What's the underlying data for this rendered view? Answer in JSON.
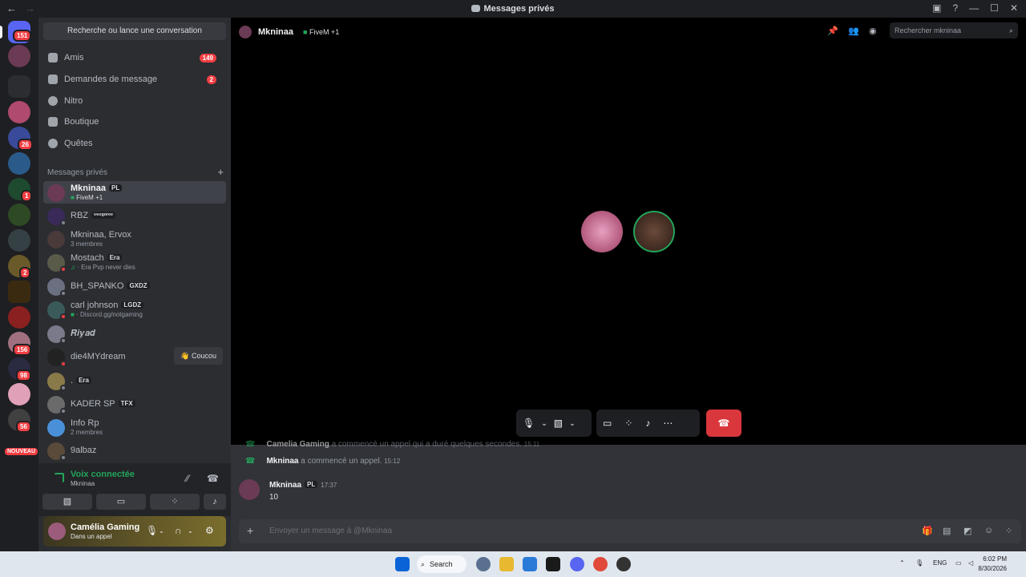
{
  "window": {
    "title": "Messages privés"
  },
  "guilds": {
    "dm_badge": "151",
    "badges": [
      "26",
      "1",
      "2",
      "156",
      "98",
      "56"
    ],
    "new_label": "NOUVEAU"
  },
  "sidebar": {
    "search_label": "Recherche ou lance une conversation",
    "nav": [
      {
        "label": "Amis",
        "count": "149"
      },
      {
        "label": "Demandes de message",
        "count": "2"
      },
      {
        "label": "Nitro",
        "count": ""
      },
      {
        "label": "Boutique",
        "count": ""
      },
      {
        "label": "Quêtes",
        "count": ""
      }
    ],
    "dm_header": "Messages privés",
    "dm_add": "+",
    "dms": [
      {
        "name": "Mkninaa",
        "tag": "PL",
        "sub": "FiveM +1",
        "active": true
      },
      {
        "name": "RBZ",
        "tag": "ᵛ⁶ᵉᵍᵒʳᵉᵉ",
        "sub": ""
      },
      {
        "name": "Mkninaa, Ervox",
        "tag": "",
        "sub": "3 membres"
      },
      {
        "name": "Mostach",
        "tag": "Era",
        "sub": "· Era Pvp never dies"
      },
      {
        "name": "BH_SPANKO",
        "tag": "GXDZ",
        "sub": ""
      },
      {
        "name": "carl johnson",
        "tag": "LGDZ",
        "sub": "· Discord.gg/notgaming"
      },
      {
        "name": "𝑹𝒊𝒚𝒂𝒅",
        "tag": "",
        "sub": ""
      },
      {
        "name": "die4MYdream",
        "tag": "",
        "sub": "",
        "action": "Coucou"
      },
      {
        "name": ".",
        "tag": "Era",
        "sub": ""
      },
      {
        "name": "KADER SP",
        "tag": "TFX",
        "sub": ""
      },
      {
        "name": "Info Rp",
        "tag": "",
        "sub": "2 membres"
      },
      {
        "name": "9albaz",
        "tag": "",
        "sub": ""
      }
    ]
  },
  "voice": {
    "status": "Voix connectée",
    "channel": "Mkninaa"
  },
  "user": {
    "name": "Camélia Gaming",
    "status": "Dans un appel"
  },
  "call": {
    "name": "Mkninaa",
    "activity": "FiveM +1",
    "search_placeholder": "Rechercher mkninaa"
  },
  "messages": {
    "system1": {
      "user": "Camelia Gaming",
      "text": "a commencé un appel qui a duré quelques secondes.",
      "time": "15:11"
    },
    "system2": {
      "user": "Mkninaa",
      "text": "a commencé un appel.",
      "time": "15:12"
    },
    "msg": {
      "user": "Mkninaa",
      "tag": "PL",
      "time": "17:37",
      "body": "10"
    }
  },
  "composer": {
    "placeholder": "Envoyer un message à @Mkninaa"
  },
  "taskbar": {
    "search": "Search",
    "lang": "ENG",
    "time": "6:02 PM",
    "date": "8/30/2026"
  },
  "colors": {
    "accent": "#5865f2",
    "green": "#23a55a",
    "red": "#f23f43"
  }
}
